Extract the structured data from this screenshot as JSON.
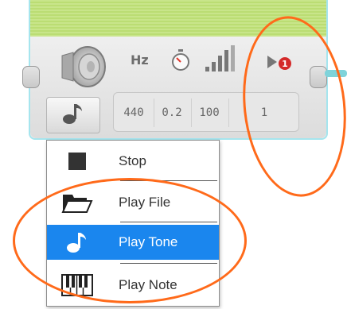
{
  "block": {
    "frequency_icon_label": "Hz",
    "parameters": [
      {
        "name": "frequency",
        "value": "440",
        "icon": "hz-icon"
      },
      {
        "name": "duration",
        "value": "0.2",
        "icon": "timer-icon"
      },
      {
        "name": "volume",
        "value": "100",
        "icon": "volume-bars-icon"
      },
      {
        "name": "play-type",
        "value": "1",
        "icon": "play-type-icon",
        "badge": "1"
      }
    ],
    "mode_icon": "music-note-icon"
  },
  "menu": {
    "items": [
      {
        "label": "Stop",
        "icon": "stop-square-icon",
        "selected": false
      },
      {
        "label": "Play File",
        "icon": "file-folder-icon",
        "selected": false
      },
      {
        "label": "Play Tone",
        "icon": "music-note-icon",
        "selected": true
      },
      {
        "label": "Play Note",
        "icon": "piano-keys-icon",
        "selected": false
      }
    ]
  },
  "colors": {
    "top_strip": "#c8e58a",
    "selected": "#1a86ee",
    "highlight_ring": "#ff6a1a",
    "wire": "#7fd3da"
  }
}
